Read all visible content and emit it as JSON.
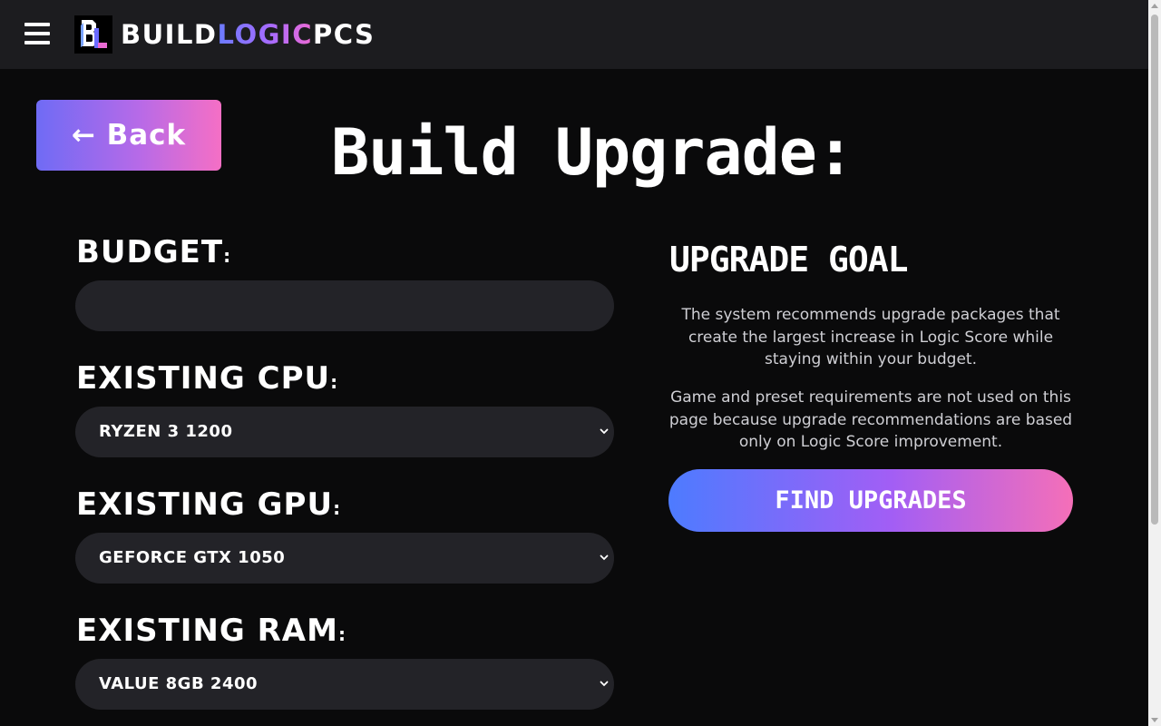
{
  "header": {
    "brand_part1": "BUILD",
    "brand_part2": "LOGIC",
    "brand_part3": "PCS",
    "menu_icon": "hamburger-menu-icon",
    "logo_icon": "bl-logo-icon"
  },
  "back_button": {
    "label": "← Back"
  },
  "page_title": "Build Upgrade:",
  "form": {
    "budget": {
      "label": "BUDGET",
      "value": ""
    },
    "cpu": {
      "label": "EXISTING CPU",
      "value": "RYZEN 3 1200"
    },
    "gpu": {
      "label": "EXISTING GPU",
      "value": "GEFORCE GTX 1050"
    },
    "ram": {
      "label": "EXISTING RAM",
      "value": "VALUE 8GB 2400"
    },
    "colon": ":"
  },
  "goal": {
    "title": "UPGRADE GOAL",
    "paragraph1": "The system recommends upgrade packages that create the largest increase in Logic Score while staying within your budget.",
    "paragraph2": "Game and preset requirements are not used on this page because upgrade recommendations are based only on Logic Score improvement.",
    "button_label": "FIND UPGRADES"
  },
  "colors": {
    "background": "#0a0a0b",
    "header_bg": "#1c1c1f",
    "field_bg": "#232328",
    "accent_blue": "#4d7bff",
    "accent_purple": "#a25ef5",
    "accent_pink": "#f56fb8"
  }
}
